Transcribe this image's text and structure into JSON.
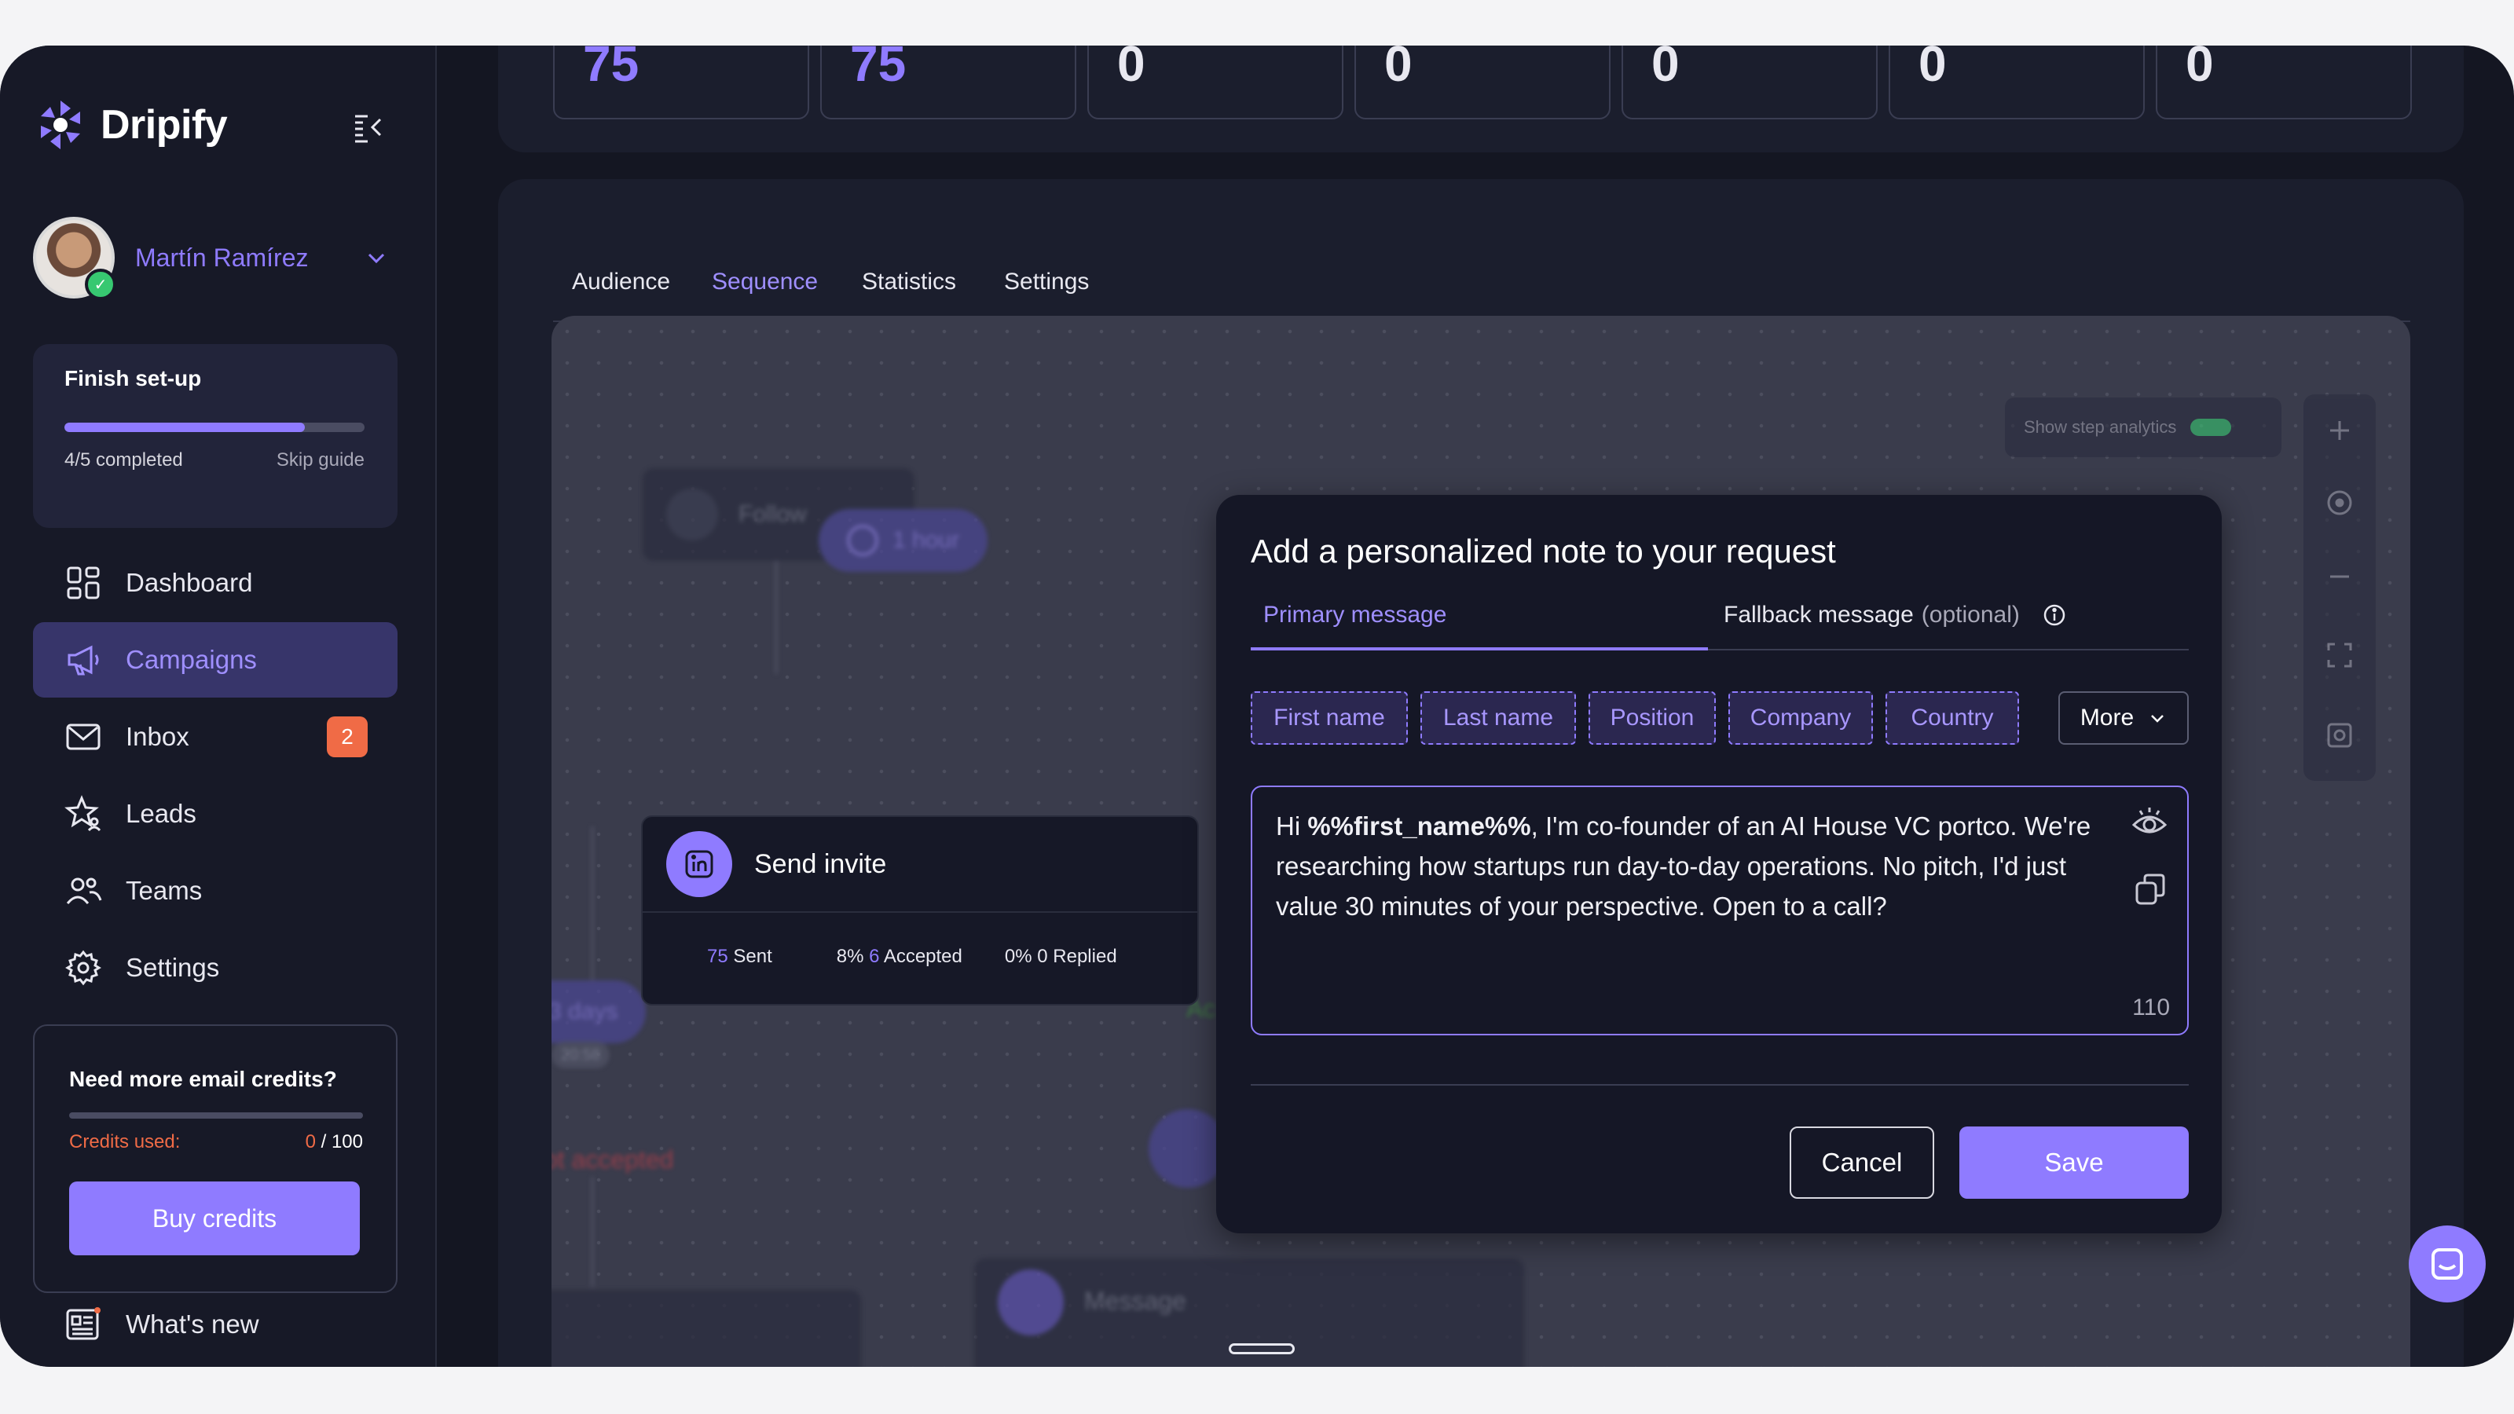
{
  "brand": {
    "name": "Dripify"
  },
  "user": {
    "name": "Martín Ramírez"
  },
  "setup": {
    "title": "Finish set-up",
    "progress_text": "4/5 completed",
    "progress_fraction": 0.8,
    "skip": "Skip guide"
  },
  "nav": {
    "dashboard": "Dashboard",
    "campaigns": "Campaigns",
    "inbox": "Inbox",
    "inbox_badge": "2",
    "leads": "Leads",
    "teams": "Teams",
    "settings": "Settings",
    "whats_new": "What's new"
  },
  "credits": {
    "title": "Need more email credits?",
    "label": "Credits used:",
    "used": "0",
    "total": " / 100",
    "button": "Buy credits"
  },
  "stats": [
    "75",
    "75",
    "0",
    "0",
    "0",
    "0",
    "0"
  ],
  "tabs": {
    "audience": "Audience",
    "sequence": "Sequence",
    "statistics": "Statistics",
    "settings": "Settings"
  },
  "canvas": {
    "follow_node": "Follow",
    "delay_1": "1 hour",
    "delay_2": "3 days",
    "delay_2_sub": "20:58",
    "not_accepted": "ot accepted",
    "accepted_partial": "Ac",
    "message_node": "Message",
    "show_step_analytics": "Show step analytics",
    "send_invite": {
      "title": "Send invite",
      "sent_num": "75",
      "sent_label": "Sent",
      "acc_pct": "8%",
      "acc_num": "6",
      "acc_label": "Accepted",
      "rep_pct": "0%",
      "rep_num": "0",
      "rep_label": "Replied"
    }
  },
  "modal": {
    "title": "Add a personalized note to your request",
    "tab_primary": "Primary message",
    "tab_fallback": "Fallback message",
    "tab_fallback_optional": "(optional)",
    "chips": [
      "First name",
      "Last name",
      "Position",
      "Company",
      "Country"
    ],
    "more": "More",
    "message_prefix": "Hi ",
    "message_var": "%%first_name%%",
    "message_rest": ", I'm co-founder of an AI House VC portco. We're researching how startups run day-to-day operations. No pitch, I'd just value 30 minutes of your perspective. Open to a call?",
    "char_count": "110",
    "cancel": "Cancel",
    "save": "Save"
  },
  "colors": {
    "accent": "#8f7bff",
    "badge": "#f06b46",
    "background": "#141622"
  },
  "icons": [
    "logo-icon",
    "collapse-sidebar-icon",
    "chevron-down-icon",
    "dashboard-icon",
    "megaphone-icon",
    "mail-icon",
    "star-person-icon",
    "team-icon",
    "gear-icon",
    "newspaper-icon",
    "linkedin-icon",
    "info-icon",
    "eye-icon",
    "copy-icon",
    "zoom-in-icon",
    "center-icon",
    "zoom-out-icon",
    "fullscreen-icon",
    "chat-icon"
  ]
}
